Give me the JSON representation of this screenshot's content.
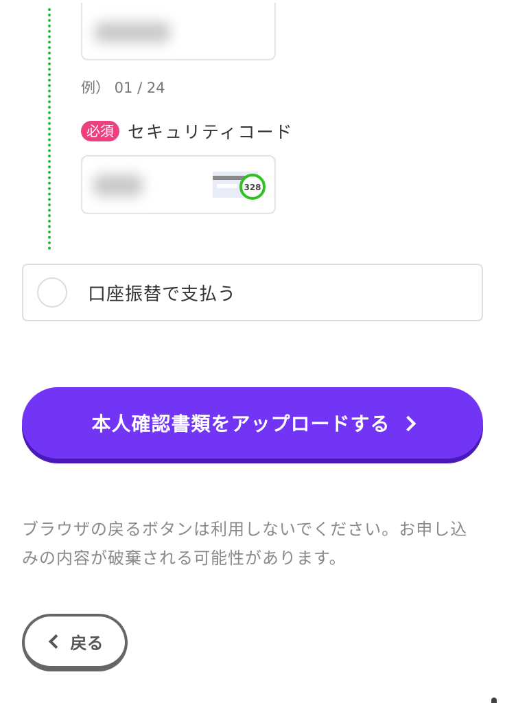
{
  "expiry": {
    "example_hint": "例） 01 / 24"
  },
  "security_code": {
    "required_badge": "必須",
    "label": "セキュリティコード",
    "card_sample_number": "328"
  },
  "payment_options": {
    "bank_transfer_label": "口座振替で支払う"
  },
  "upload_button": {
    "label": "本人確認書類をアップロードする"
  },
  "notice": {
    "text": "ブラウザの戻るボタンは利用しないでください。お申し込みの内容が破棄される可能性があります。"
  },
  "back_button": {
    "label": "戻る"
  },
  "colors": {
    "accent": "#7235f5",
    "accent_shadow": "#4a17b8",
    "required_badge": "#ee3f7f",
    "dotted_line": "#22b53a"
  },
  "icons": {
    "upload_chevron": "chevron-right-icon",
    "back_chevron": "chevron-left-icon",
    "cvc": "card-cvc-icon"
  }
}
